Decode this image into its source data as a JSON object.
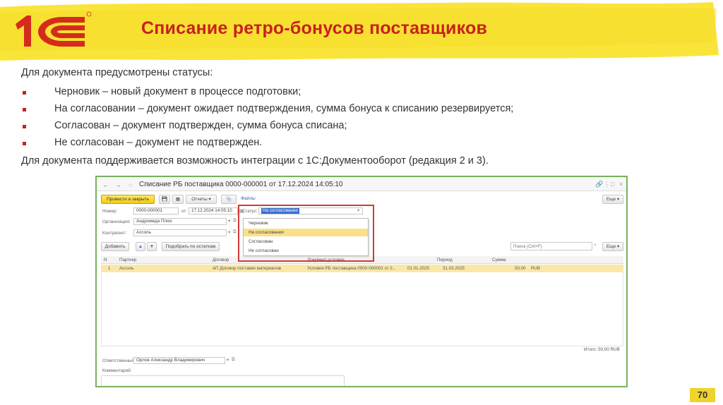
{
  "slide": {
    "title": "Списание ретро-бонусов поставщиков",
    "intro": "Для документа предусмотрены статусы:",
    "bullets": [
      "Черновик – новый документ в процессе подготовки;",
      "На согласовании – документ ожидает подтверждения, сумма бонуса к списанию резервируется;",
      "Согласован – документ подтвержден, сумма бонуса списана;",
      "Не согласован – документ не подтвержден."
    ],
    "outro": "Для документа поддерживается возможность интеграции с 1С:Документооборот (редакция 2 и 3).",
    "page_number": "70",
    "colors": {
      "title": "#c8201f",
      "header_yellow": "#f9e53a",
      "logo_red": "#d52b1e",
      "bullet": "#c8201f"
    }
  },
  "app": {
    "window_title": "Списание РБ поставщика 0000-000001 от 17.12.2024 14:05:10",
    "nav": {
      "back": "←",
      "forward": "→",
      "star": "☆"
    },
    "window_controls": {
      "link": "🔗",
      "more": "⋮",
      "maximize": "□",
      "close": "×"
    },
    "toolbar": {
      "post_close": "Провести и закрыть",
      "save": "💾",
      "post": "▦",
      "reports": "Отчеты ▾",
      "attach": "📎",
      "files": "Файлы",
      "more": "Еще ▾"
    },
    "form": {
      "number_label": "Номер:",
      "number_value": "0000-000001",
      "date_label": "от:",
      "date_value": "17.12.2024 14:05:10",
      "status_label": "Статус:",
      "status_value": "На согласовании",
      "org_label": "Организация:",
      "org_value": "Андромеда Плюс",
      "contragent_label": "Контрагент:",
      "contragent_value": "Ассоль"
    },
    "status_options": [
      "Черновик",
      "На согласовании",
      "Согласован",
      "Не согласован"
    ],
    "status_selected_index": 1,
    "table_toolbar": {
      "add": "Добавить",
      "up": "▲",
      "down": "▼",
      "fill": "Подобрать по остаткам",
      "search_placeholder": "Поиск (Ctrl+F)",
      "more": "Еще ▾"
    },
    "table": {
      "columns": [
        "N",
        "Партнер",
        "Договор",
        "Документ-условие",
        "",
        "Период",
        "Сумма"
      ],
      "rows": [
        [
          "1",
          "Ассоль",
          "АП Договор поставки материалов",
          "Условия РБ поставщика 0000-000002 от 2...",
          "01.01.2025",
          "31.03.2025",
          "50,00",
          "RUB"
        ]
      ]
    },
    "total": "Итого: 50,00 RUB",
    "responsible_label": "Ответственный:",
    "responsible_value": "Орлов Александр Владимирович",
    "comment_label": "Комментарий:"
  }
}
